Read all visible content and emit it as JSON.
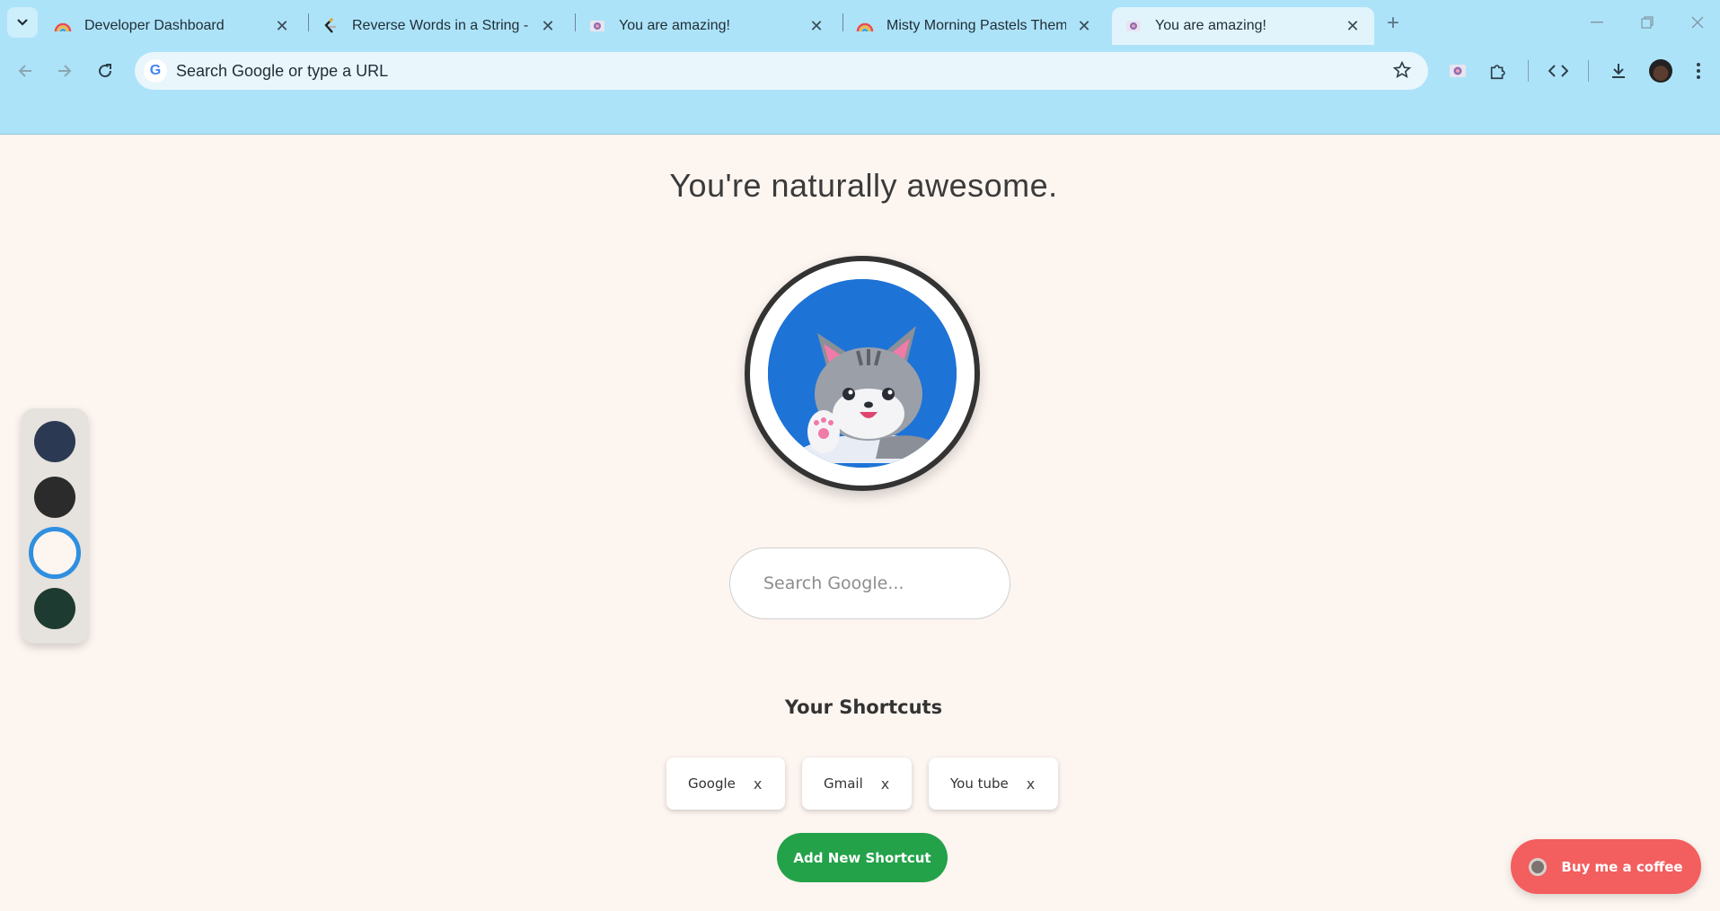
{
  "browser": {
    "tabs": [
      {
        "title": "Developer Dashboard",
        "icon": "rainbow-icon",
        "active": false
      },
      {
        "title": "Reverse Words in a String - LeetCode",
        "icon": "leetcode-icon",
        "active": false
      },
      {
        "title": "You are amazing!",
        "icon": "extension-page-icon",
        "active": false
      },
      {
        "title": "Misty Morning Pastels Theme - Chrome Web Store",
        "icon": "rainbow-icon",
        "active": false
      },
      {
        "title": "You are amazing!",
        "icon": "extension-page-icon",
        "active": true
      }
    ],
    "omnibox_placeholder": "Search Google or type a URL",
    "accent": "#ade3f9"
  },
  "page": {
    "headline": "You're naturally awesome.",
    "search_placeholder": "Search Google...",
    "shortcuts_title": "Your Shortcuts",
    "shortcuts": [
      {
        "label": "Google",
        "remove": "x"
      },
      {
        "label": "Gmail",
        "remove": "x"
      },
      {
        "label": "You tube",
        "remove": "x"
      }
    ],
    "add_shortcut_label": "Add New Shortcut",
    "coffee_label": "Buy me a coffee",
    "theme_swatches": [
      {
        "color": "#2b3a52",
        "selected": false
      },
      {
        "color": "#2b2b2b",
        "selected": false
      },
      {
        "color": "#fdf5f0",
        "selected": true
      },
      {
        "color": "#1d3b30",
        "selected": false
      }
    ],
    "colors": {
      "background": "#fdf5f0",
      "add_button": "#23a24a",
      "coffee_button": "#f35e5e",
      "selected_ring": "#2f8fe0"
    }
  }
}
